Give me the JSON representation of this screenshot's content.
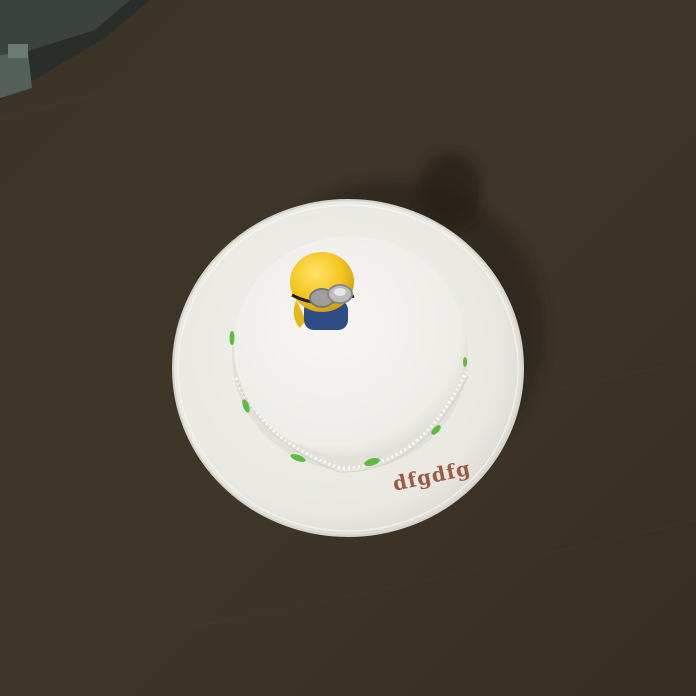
{
  "scene": {
    "type": "3d-top-down-view",
    "objects": [
      "wooden-table",
      "chair-corner",
      "plate",
      "round-cake",
      "minion-figurine",
      "green-leaf-decorations"
    ]
  },
  "plate": {
    "inscription": "dfgdfg",
    "inscription_color": "#9b5a43"
  },
  "colors": {
    "table": "#3e3528",
    "plate": "#ecebe6",
    "cake": "#f1f0ec",
    "leaf": "#5dbb3e",
    "minion_yellow": "#f2c21e",
    "minion_blue": "#2e4c86",
    "goggles": "#bdbdbd"
  }
}
